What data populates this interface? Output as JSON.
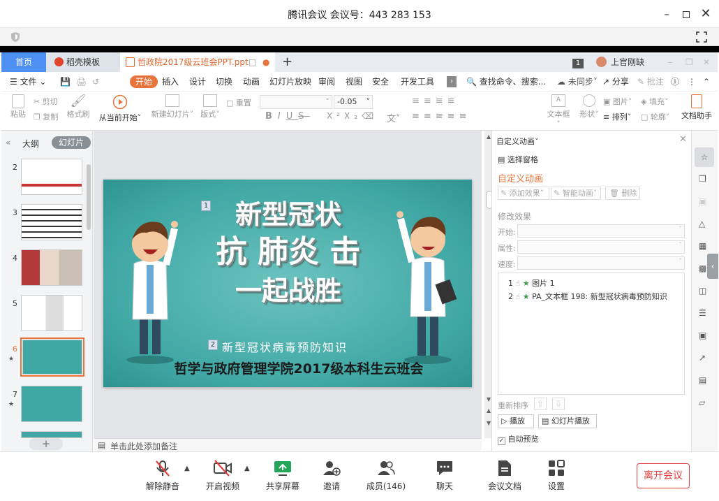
{
  "meeting": {
    "title": "腾讯会议 会议号：443 283 153",
    "leave_label": "离开会议"
  },
  "wps": {
    "tabs": {
      "home": "首页",
      "template": "稻壳模板",
      "doc": "哲政院2017级云班会PPT.ppt"
    },
    "page_indicator": "1",
    "user_name": "上官刚缺",
    "menu": {
      "file": "文件",
      "items": [
        "开始",
        "插入",
        "设计",
        "切换",
        "动画",
        "幻灯片放映",
        "审阅",
        "视图",
        "安全",
        "开发工具"
      ],
      "search": "查找命令、搜索...",
      "sync": "未同步",
      "share": "分享",
      "annotate": "批注"
    },
    "ribbon": {
      "paste": "粘贴",
      "cut": "剪切",
      "copy": "复制",
      "format_painter": "格式刷",
      "play_from": "从当前开始",
      "new_slide": "新建幻灯片",
      "layout": "版式",
      "reset": "重置",
      "font_size": "-0.05",
      "textbox": "文本框",
      "shape": "形状",
      "picture": "图片",
      "fill": "填充",
      "arrange": "排列",
      "outline": "轮廓",
      "doc_assistant": "文档助手"
    },
    "left_pane": {
      "outline_tab": "大纲",
      "slides_tab": "幻灯片",
      "thumbs": [
        "2",
        "3",
        "4",
        "5",
        "6",
        "7"
      ]
    },
    "slide": {
      "title_line1": "新型冠状",
      "title_line2": "抗 肺炎 击",
      "title_line3": "一起战胜",
      "tag1": "1",
      "tag2": "2",
      "subtitle": "新型冠状病毒预防知识",
      "footer": "哲学与政府管理学院2017级本科生云班会"
    },
    "notes_placeholder": "单击此处添加备注",
    "anim_panel": {
      "header": "自定义动画",
      "select_pane": "选择窗格",
      "title": "自定义动画",
      "add_effect": "添加效果",
      "smart_anim": "智能动画",
      "delete": "删除",
      "modify": "修改效果",
      "start_label": "开始:",
      "prop_label": "属性:",
      "speed_label": "速度:",
      "items": [
        {
          "num": "1",
          "name": "图片 1"
        },
        {
          "num": "2",
          "name": "PA_文本框 198: 新型冠状病毒预防知识"
        }
      ],
      "reorder": "重新排序",
      "play": "播放",
      "slideshow": "幻灯片播放",
      "autopreview": "自动预览"
    }
  },
  "bottom": {
    "unmute": "解除静音",
    "video": "开启视频",
    "share": "共享屏幕",
    "invite": "邀请",
    "members": "成员(146)",
    "chat": "聊天",
    "docs": "会议文档",
    "settings": "设置"
  },
  "colors": {
    "slide_bg": "#3fa7a4",
    "accent_orange": "#e8743b",
    "leave_red": "#e53d3d",
    "home_tab_blue": "#4e8ff2"
  }
}
